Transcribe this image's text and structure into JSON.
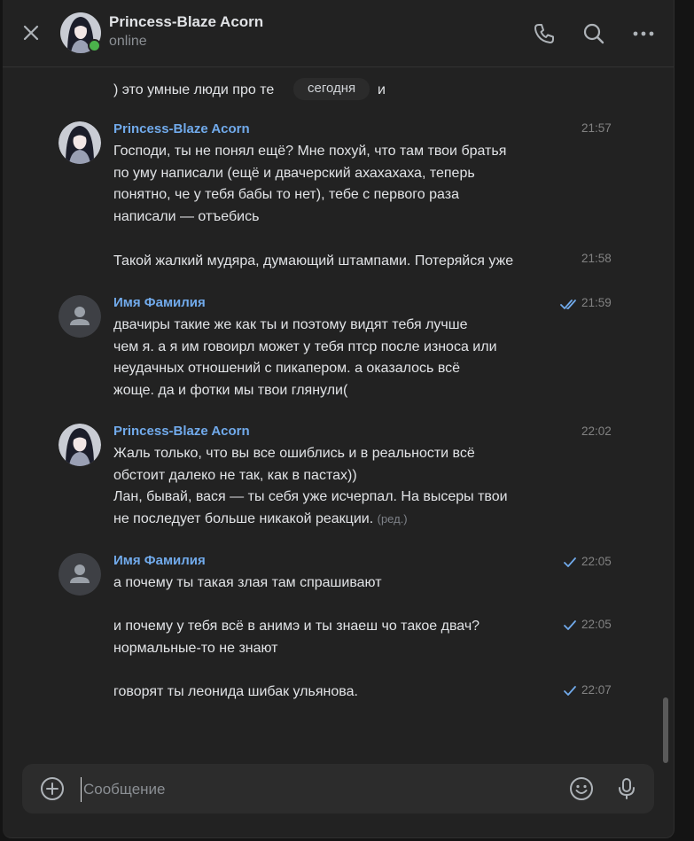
{
  "header": {
    "name": "Princess-Blaze Acorn",
    "status": "online"
  },
  "feed": {
    "partial_text": ") это умные люди про те",
    "partial_tail": "и",
    "date_separator": "сегодня",
    "messages": [
      {
        "sender": "Princess-Blaze Acorn",
        "time": "21:57",
        "lines": [
          "Господи, ты не понял ещё? Мне похуй, что там твои братья",
          "по уму написали (ещё и двачерский ахахахаха, теперь",
          "понятно, че у тебя бабы то нет), тебе с первого раза",
          "написали — отъебись"
        ]
      },
      {
        "time": "21:58",
        "lines": [
          "Такой жалкий мудяра, думающий штампами. Потеряйся уже"
        ]
      },
      {
        "sender": "Имя Фамилия",
        "time": "21:59",
        "lines": [
          "двачиры такие же как ты и поэтому видят тебя лучше",
          "чем я. а я им говоирл может у тебя птср после износа или",
          "неудачных отношений с пикапером. а оказалось всё",
          "жоще. да и фотки мы твои глянули("
        ]
      },
      {
        "sender": "Princess-Blaze Acorn",
        "time": "22:02",
        "lines": [
          "Жаль только, что вы все ошиблись и в реальности всё",
          "обстоит далеко не так, как в пастах))",
          "Лан, бывай, вася — ты себя уже исчерпал. На высеры твои",
          "не последует больше никакой реакции."
        ],
        "edited": "(ред.)"
      },
      {
        "sender": "Имя Фамилия",
        "time": "22:05",
        "lines": [
          "а почему ты такая злая там спрашивают"
        ]
      },
      {
        "time": "22:05",
        "lines": [
          "и почему у тебя всё в анимэ и ты знаеш чо такое двач?",
          "нормальные-то не знают"
        ]
      },
      {
        "time": "22:07",
        "lines": [
          "говорят ты леонида шибак ульянова."
        ]
      }
    ]
  },
  "composer": {
    "placeholder": "Сообщение"
  },
  "colors": {
    "background": "#222222",
    "accent": "#71aaeb",
    "text": "#e1e3e6",
    "muted": "#828282",
    "online": "#4bb34b"
  },
  "icons": [
    "close-icon",
    "phone-icon",
    "search-icon",
    "more-icon",
    "add-icon",
    "emoji-icon",
    "microphone-icon",
    "read-check-icon",
    "sent-check-icon"
  ]
}
